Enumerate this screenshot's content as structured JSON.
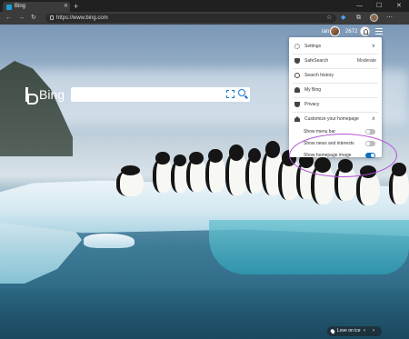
{
  "browser": {
    "tab_title": "Bing",
    "tab_close": "✕",
    "new_tab": "+",
    "minimize": "—",
    "maximize": "☐",
    "close_window": "✕",
    "back": "←",
    "forward": "→",
    "refresh": "↻",
    "url": "https://www.bing.com",
    "star": "☆",
    "collections": "⧉",
    "more": "⋯"
  },
  "header": {
    "user_name": "Ian",
    "rewards_points": "2672"
  },
  "search": {
    "logo_text": "Bing"
  },
  "settings_panel": {
    "items": [
      {
        "icon": "gear-icon",
        "label": "Settings",
        "value": "∨"
      },
      {
        "icon": "shield-icon",
        "label": "SafeSearch",
        "value": "Moderate"
      },
      {
        "icon": "clock-icon",
        "label": "Search history",
        "value": ""
      },
      {
        "icon": "person-icon",
        "label": "My Bing",
        "value": ""
      },
      {
        "icon": "privacy-shield-icon",
        "label": "Privacy",
        "value": ""
      },
      {
        "icon": "house-icon",
        "label": "Customize your homepage",
        "value": "∧"
      }
    ],
    "toggles": [
      {
        "label": "Show menu bar",
        "on": false
      },
      {
        "label": "Show news and interests",
        "on": false
      },
      {
        "label": "Show homepage image",
        "on": true
      }
    ]
  },
  "footer": {
    "image_caption": "Love on ice",
    "prev": "‹",
    "next": "›"
  },
  "colors": {
    "accent": "#0f6cbd",
    "highlight": "#b24fd6"
  }
}
